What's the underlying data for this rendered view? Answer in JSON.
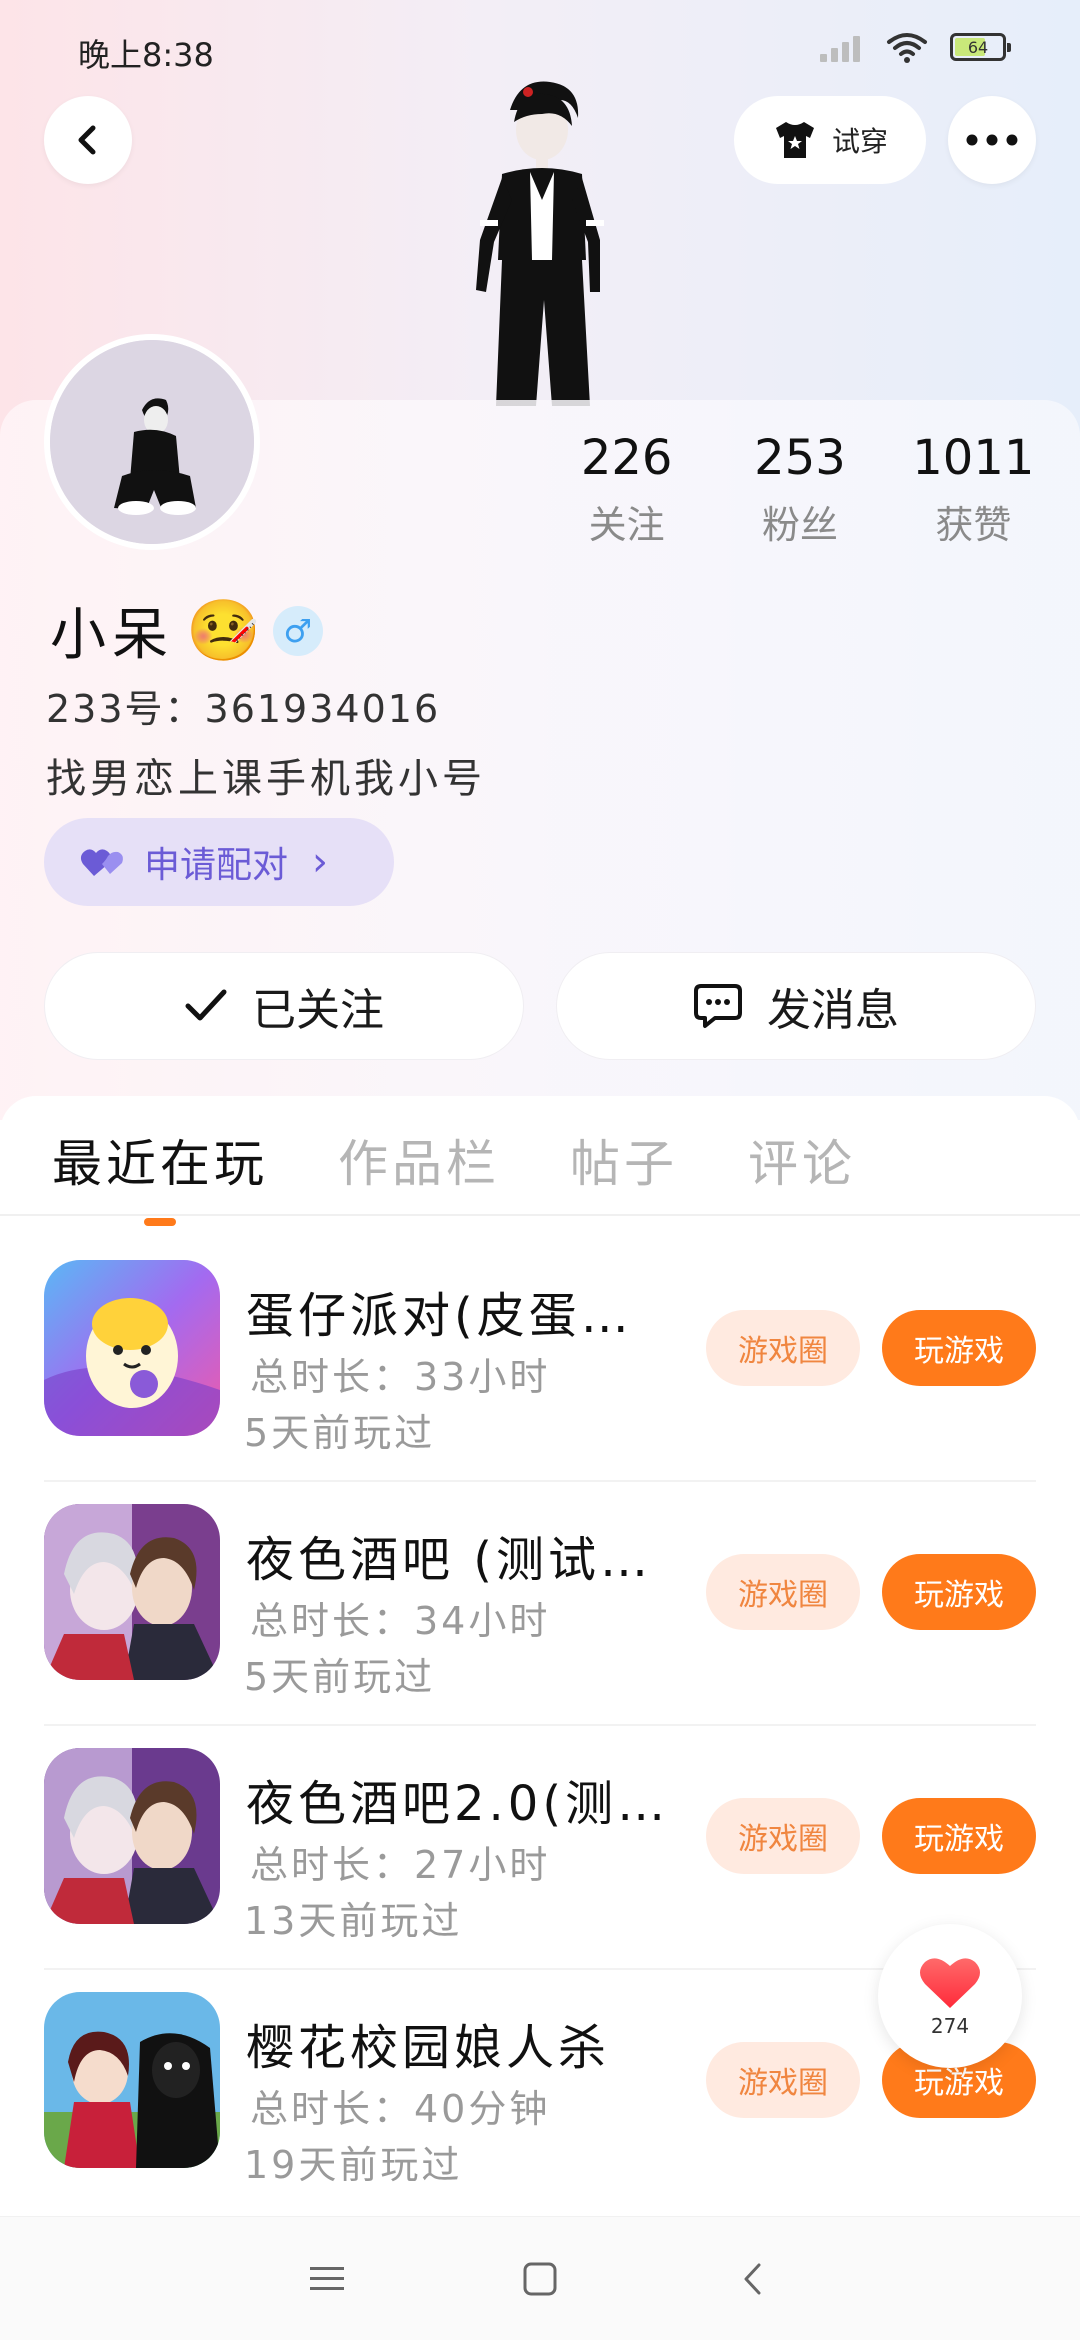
{
  "status_bar": {
    "time": "晚上8:38",
    "battery": "64"
  },
  "header": {
    "try_on_label": "试穿"
  },
  "profile": {
    "stats": [
      {
        "value": "226",
        "label": "关注"
      },
      {
        "value": "253",
        "label": "粉丝"
      },
      {
        "value": "1011",
        "label": "获赞"
      }
    ],
    "username": "小呆",
    "emoji": "🤒",
    "gender_symbol": "♂",
    "user_id": "233号：361934016",
    "bio": "找男恋上课手机我小号",
    "pair_label": "申请配对",
    "pair_chevron": "›"
  },
  "actions": {
    "follow_label": "已关注",
    "message_label": "发消息"
  },
  "tabs": [
    {
      "label": "最近在玩",
      "active": true
    },
    {
      "label": "作品栏",
      "active": false
    },
    {
      "label": "帖子",
      "active": false
    },
    {
      "label": "评论",
      "active": false
    }
  ],
  "games": [
    {
      "title": "蛋仔派对(皮蛋…",
      "duration": "总时长：33小时",
      "last_played": "5天前玩过",
      "circle_label": "游戏圈",
      "play_label": "玩游戏"
    },
    {
      "title": "夜色酒吧 (测试…",
      "duration": "总时长：34小时",
      "last_played": "5天前玩过",
      "circle_label": "游戏圈",
      "play_label": "玩游戏"
    },
    {
      "title": "夜色酒吧2.0(测…",
      "duration": "总时长：27小时",
      "last_played": "13天前玩过",
      "circle_label": "游戏圈",
      "play_label": "玩游戏"
    },
    {
      "title": "樱花校园娘人杀",
      "duration": "总时长：40分钟",
      "last_played": "19天前玩过",
      "circle_label": "游戏圈",
      "play_label": "玩游戏"
    }
  ],
  "like_float": {
    "count": "274"
  },
  "colors": {
    "accent": "#ff7a1a",
    "pair_purple": "#6b5bd6",
    "circle_bg": "#ffeae0"
  }
}
